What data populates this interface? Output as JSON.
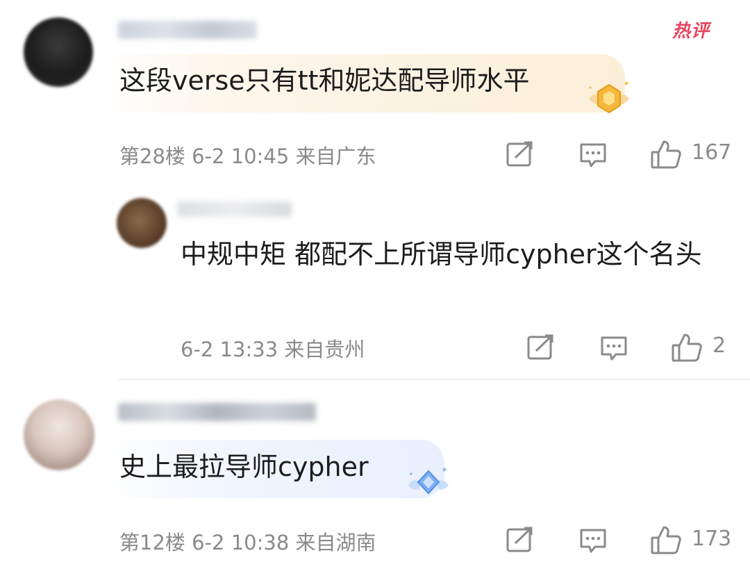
{
  "comments": [
    {
      "text": "这段verse只有tt和妮达配导师水平",
      "meta": "第28楼  6-2 10:45  来自广东",
      "likes": "167",
      "tag": "热评"
    },
    {
      "text": "中规中矩 都配不上所谓导师cypher这个名头",
      "meta": "6-2 13:33  来自贵州",
      "likes": "2"
    },
    {
      "text": "史上最拉导师cypher",
      "meta": "第12楼  6-2 10:38  来自湖南",
      "likes": "173"
    }
  ],
  "icons": {
    "share": "share-icon",
    "reply": "comment-icon",
    "like": "thumbs-up-icon"
  },
  "colors": {
    "hot_tag": "#e94560",
    "meta_text": "#8a8a8a",
    "gold_bubble": "#fbefd9",
    "blue_bubble": "#e9f0fd"
  }
}
